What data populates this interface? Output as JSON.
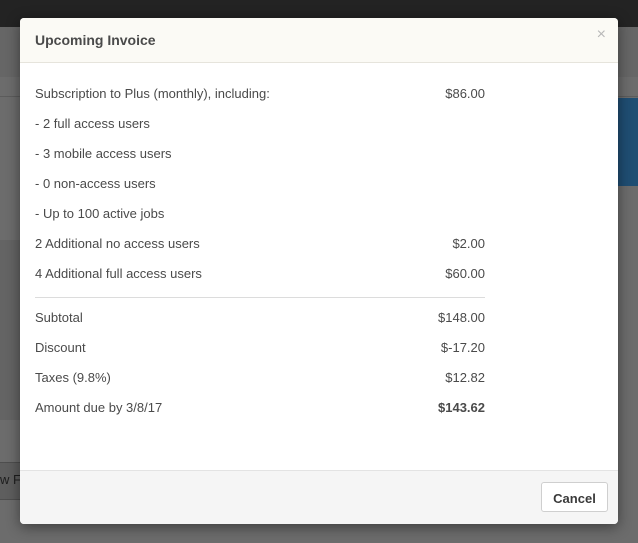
{
  "background": {
    "partial_button_text": "w F"
  },
  "modal": {
    "title": "Upcoming Invoice",
    "close_label": "×",
    "line_items": [
      {
        "label": "Subscription to Plus (monthly), including:",
        "amount": "$86.00"
      },
      {
        "label": "- 2 full access users",
        "amount": ""
      },
      {
        "label": "- 3 mobile access users",
        "amount": ""
      },
      {
        "label": "- 0 non-access users",
        "amount": ""
      },
      {
        "label": "- Up to 100 active jobs",
        "amount": ""
      },
      {
        "label": "2 Additional no access users",
        "amount": "$2.00"
      },
      {
        "label": "4 Additional full access users",
        "amount": "$60.00"
      }
    ],
    "totals": {
      "subtotal": {
        "label": "Subtotal",
        "amount": "$148.00"
      },
      "discount": {
        "label": "Discount",
        "amount": "$-17.20"
      },
      "taxes": {
        "label": "Taxes (9.8%)",
        "amount": "$12.82"
      },
      "amount_due": {
        "label": "Amount due by 3/8/17",
        "amount": "$143.62"
      }
    },
    "footer": {
      "cancel_label": "Cancel"
    }
  }
}
